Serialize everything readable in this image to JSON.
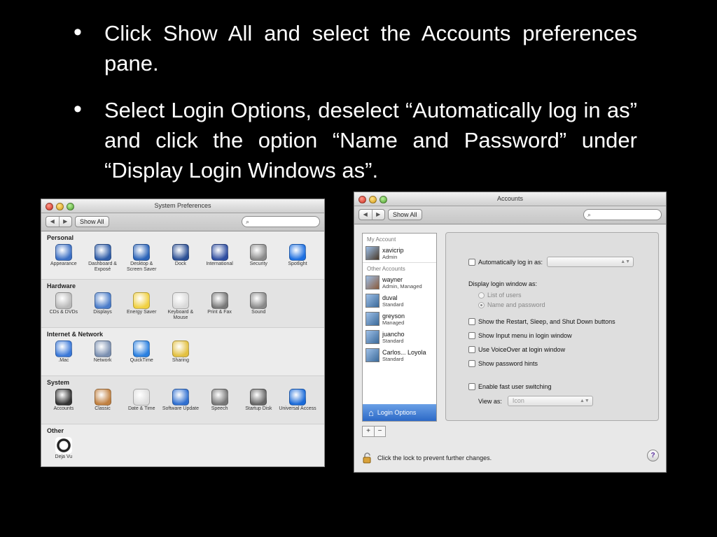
{
  "slide": {
    "bullets": [
      "Click Show All and select the Accounts preferences pane.",
      "Select Login Options, deselect “Automatically log in as” and click the option “Name and Password” under “Display Login Windows as”."
    ]
  },
  "sysprefs": {
    "title": "System Preferences",
    "show_all": "Show All",
    "sections": [
      {
        "title": "Personal",
        "items": [
          {
            "label": "Appearance",
            "icon": "appearance-icon",
            "color": "#3b6fc4"
          },
          {
            "label": "Dashboard & Exposé",
            "icon": "dashboard-icon",
            "color": "#2f5da8"
          },
          {
            "label": "Desktop & Screen Saver",
            "icon": "desktop-icon",
            "color": "#2a63b8"
          },
          {
            "label": "Dock",
            "icon": "dock-icon",
            "color": "#2b4f94"
          },
          {
            "label": "International",
            "icon": "international-icon",
            "color": "#2f4ea0"
          },
          {
            "label": "Security",
            "icon": "security-icon",
            "color": "#8a8a8a"
          },
          {
            "label": "Spotlight",
            "icon": "spotlight-icon",
            "color": "#1d6fe0"
          }
        ]
      },
      {
        "title": "Hardware",
        "items": [
          {
            "label": "CDs & DVDs",
            "icon": "cd-icon",
            "color": "#b9b9b9"
          },
          {
            "label": "Displays",
            "icon": "displays-icon",
            "color": "#4a7cc9"
          },
          {
            "label": "Energy Saver",
            "icon": "energy-saver-icon",
            "color": "#f0d040"
          },
          {
            "label": "Keyboard & Mouse",
            "icon": "keyboard-icon",
            "color": "#d9d9d9"
          },
          {
            "label": "Print & Fax",
            "icon": "printer-icon",
            "color": "#777777"
          },
          {
            "label": "Sound",
            "icon": "sound-icon",
            "color": "#888888"
          }
        ]
      },
      {
        "title": "Internet & Network",
        "items": [
          {
            "label": ".Mac",
            "icon": "mac-icon",
            "color": "#3a78d8"
          },
          {
            "label": "Network",
            "icon": "network-icon",
            "color": "#7a8fb0"
          },
          {
            "label": "QuickTime",
            "icon": "quicktime-icon",
            "color": "#2a80e0"
          },
          {
            "label": "Sharing",
            "icon": "sharing-icon",
            "color": "#e3c040"
          }
        ]
      },
      {
        "title": "System",
        "items": [
          {
            "label": "Accounts",
            "icon": "accounts-icon",
            "color": "#333333"
          },
          {
            "label": "Classic",
            "icon": "classic-icon",
            "color": "#c08040"
          },
          {
            "label": "Date & Time",
            "icon": "date-time-icon",
            "color": "#dddddd"
          },
          {
            "label": "Software Update",
            "icon": "software-update-icon",
            "color": "#2f6fd0"
          },
          {
            "label": "Speech",
            "icon": "speech-icon",
            "color": "#777777"
          },
          {
            "label": "Startup Disk",
            "icon": "startup-disk-icon",
            "color": "#666666"
          },
          {
            "label": "Universal Access",
            "icon": "universal-access-icon",
            "color": "#1a6ad8"
          }
        ]
      }
    ],
    "other_title": "Other",
    "other_item": {
      "label": "Deja Vu",
      "icon": "deja-vu-icon",
      "color": "#222222"
    }
  },
  "accounts": {
    "title": "Accounts",
    "show_all": "Show All",
    "my_account_label": "My Account",
    "other_accounts_label": "Other Accounts",
    "users": [
      {
        "name": "xavicrip",
        "role": "Admin",
        "color": "#4a3a2a"
      },
      {
        "name": "wayner",
        "role": "Admin, Managed",
        "color": "#8a5a3a"
      },
      {
        "name": "duval",
        "role": "Standard",
        "color": "#3b6a9a"
      },
      {
        "name": "greyson",
        "role": "Managed",
        "color": "#3b6a9a"
      },
      {
        "name": "juancho",
        "role": "Standard",
        "color": "#3b6a9a"
      },
      {
        "name": "Carlos... Loyola",
        "role": "Standard",
        "color": "#3b6a9a"
      }
    ],
    "login_options": "Login Options",
    "plus": "+",
    "minus": "−",
    "options": {
      "auto_login": "Automatically log in as:",
      "display_login_window": "Display login window as:",
      "list_of_users": "List of users",
      "name_and_password": "Name and password",
      "show_restart": "Show the Restart, Sleep, and Shut Down buttons",
      "show_input_menu": "Show Input menu in login window",
      "use_voiceover": "Use VoiceOver at login window",
      "show_password_hints": "Show password hints",
      "fast_user_switching": "Enable fast user switching",
      "view_as": "View as:",
      "view_as_value": "Icon"
    },
    "lock_text": "Click the lock to prevent further changes.",
    "help": "?"
  }
}
